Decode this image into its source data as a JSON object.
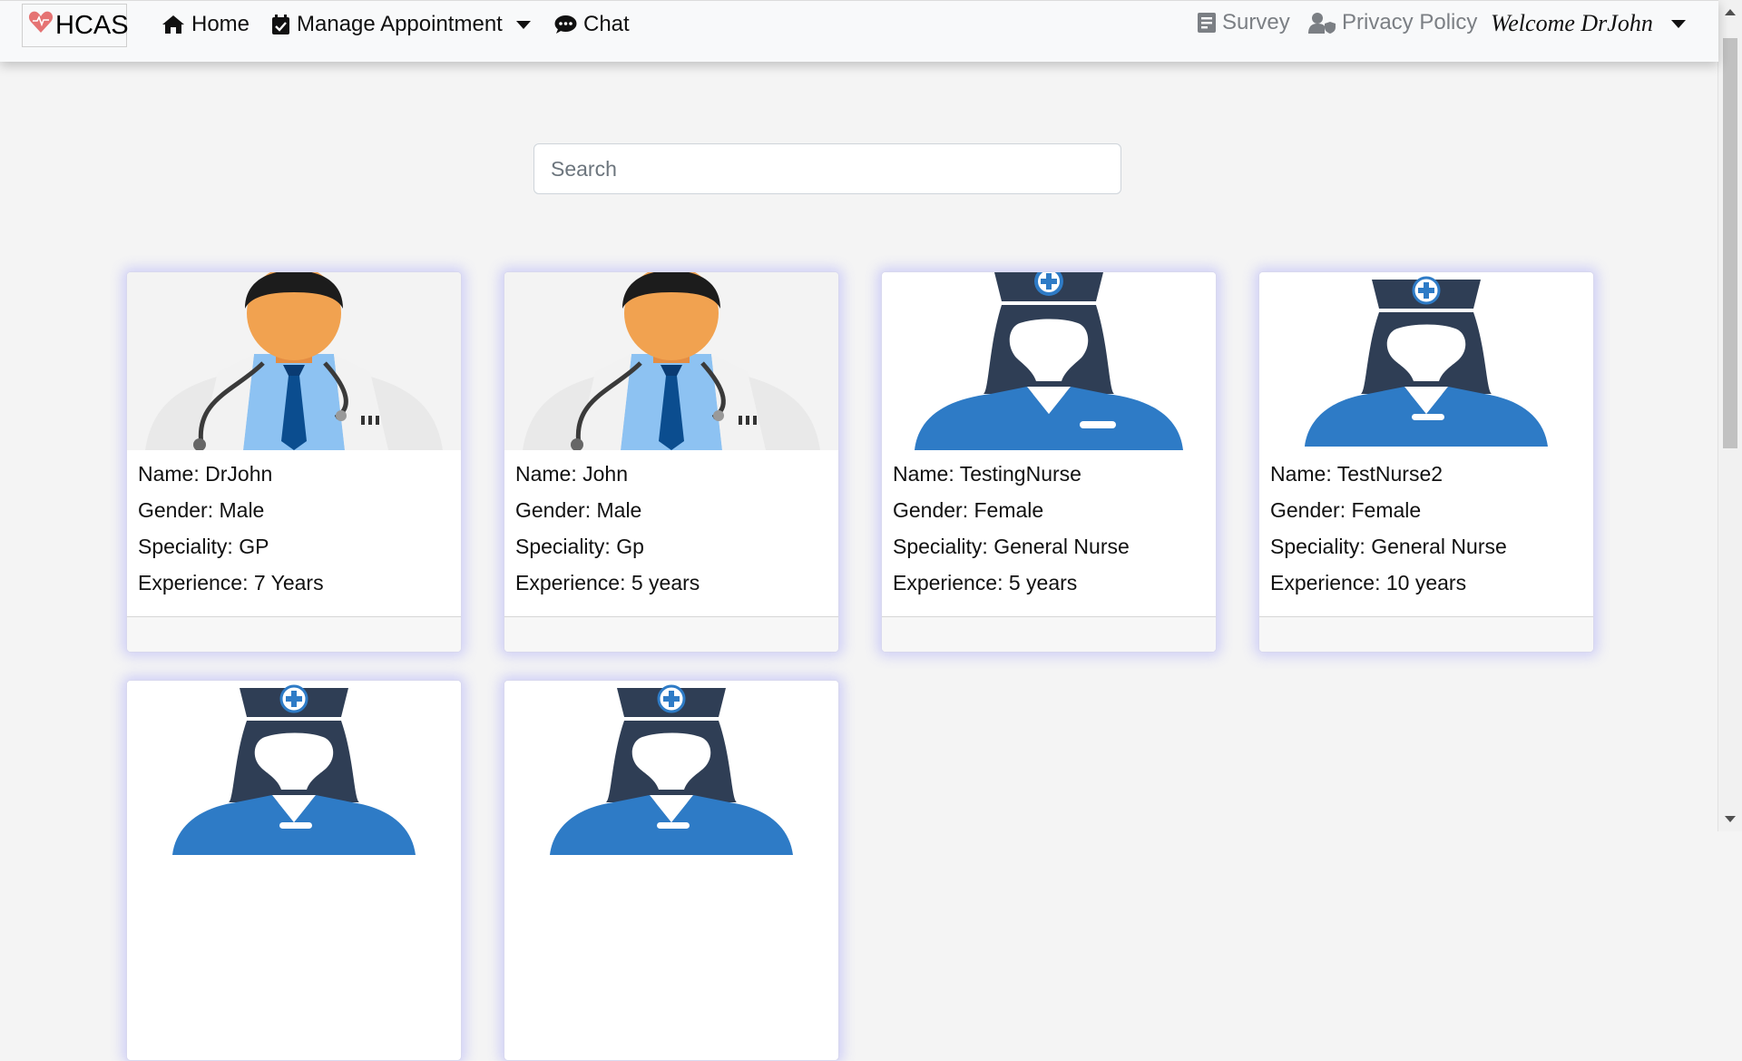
{
  "nav": {
    "brand": "HCAS",
    "home": "Home",
    "manage_appointment": "Manage Appointment",
    "chat": "Chat",
    "survey": "Survey",
    "privacy_policy": "Privacy Policy",
    "welcome": "Welcome DrJohn"
  },
  "search": {
    "placeholder": "Search"
  },
  "staff": [
    {
      "name": "Name: DrJohn",
      "gender": "Gender: Male",
      "speciality": "Speciality: GP",
      "experience": "Experience: 7 Years",
      "image": "doctor-avatar"
    },
    {
      "name": "Name: John",
      "gender": "Gender: Male",
      "speciality": "Speciality: Gp",
      "experience": "Experience: 5 years",
      "image": "doctor-avatar"
    },
    {
      "name": "Name: TestingNurse",
      "gender": "Gender: Female",
      "speciality": "Speciality: General Nurse",
      "experience": "Experience: 5 years",
      "image": "nurse-avatar"
    },
    {
      "name": "Name: TestNurse2",
      "gender": "Gender: Female",
      "speciality": "Speciality: General Nurse",
      "experience": "Experience: 10 years",
      "image": "nurse-avatar"
    },
    {
      "image": "nurse-avatar"
    },
    {
      "image": "nurse-avatar"
    }
  ],
  "colors": {
    "accent_shadow": "#7878ff",
    "nurse_blue": "#2e7bc6",
    "nurse_dark": "#2f3e55",
    "heart": "#e57373"
  }
}
